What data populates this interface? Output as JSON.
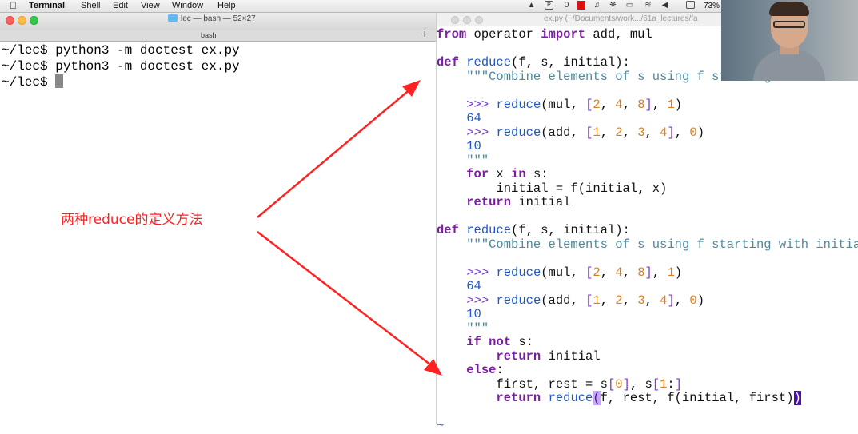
{
  "menubar": {
    "app": "Terminal",
    "items": [
      "Shell",
      "Edit",
      "View",
      "Window",
      "Help"
    ],
    "battery": "73%"
  },
  "terminal": {
    "window_title": "lec — bash — 52×27",
    "tab_label": "bash",
    "lines": [
      "~/lec$ python3 -m doctest ex.py",
      "~/lec$ python3 -m doctest ex.py",
      "~/lec$ "
    ]
  },
  "editor": {
    "window_title": "ex.py (~/Documents/work.../61a_lectures/fa",
    "lines": [
      "from operator import add, mul",
      "",
      "def reduce(f, s, initial):",
      "    \"\"\"Combine elements of s using f starting with initial.",
      "",
      "    >>> reduce(mul, [2, 4, 8], 1)",
      "    64",
      "    >>> reduce(add, [1, 2, 3, 4], 0)",
      "    10",
      "    \"\"\"",
      "    for x in s:",
      "        initial = f(initial, x)",
      "    return initial",
      "",
      "def reduce(f, s, initial):",
      "    \"\"\"Combine elements of s using f starting with initial.",
      "",
      "    >>> reduce(mul, [2, 4, 8], 1)",
      "    64",
      "    >>> reduce(add, [1, 2, 3, 4], 0)",
      "    10",
      "    \"\"\"",
      "    if not s:",
      "        return initial",
      "    else:",
      "        first, rest = s[0], s[1:]",
      "        return reduce(f, rest, f(initial, first))",
      "",
      "~"
    ]
  },
  "annotation": {
    "text": "两种reduce的定义方法",
    "color": "#ff2222"
  },
  "colors": {
    "keyword": "#7a1fa2",
    "function": "#1e56c8",
    "number": "#d97e1e",
    "docstring": "#4a8a9e"
  }
}
